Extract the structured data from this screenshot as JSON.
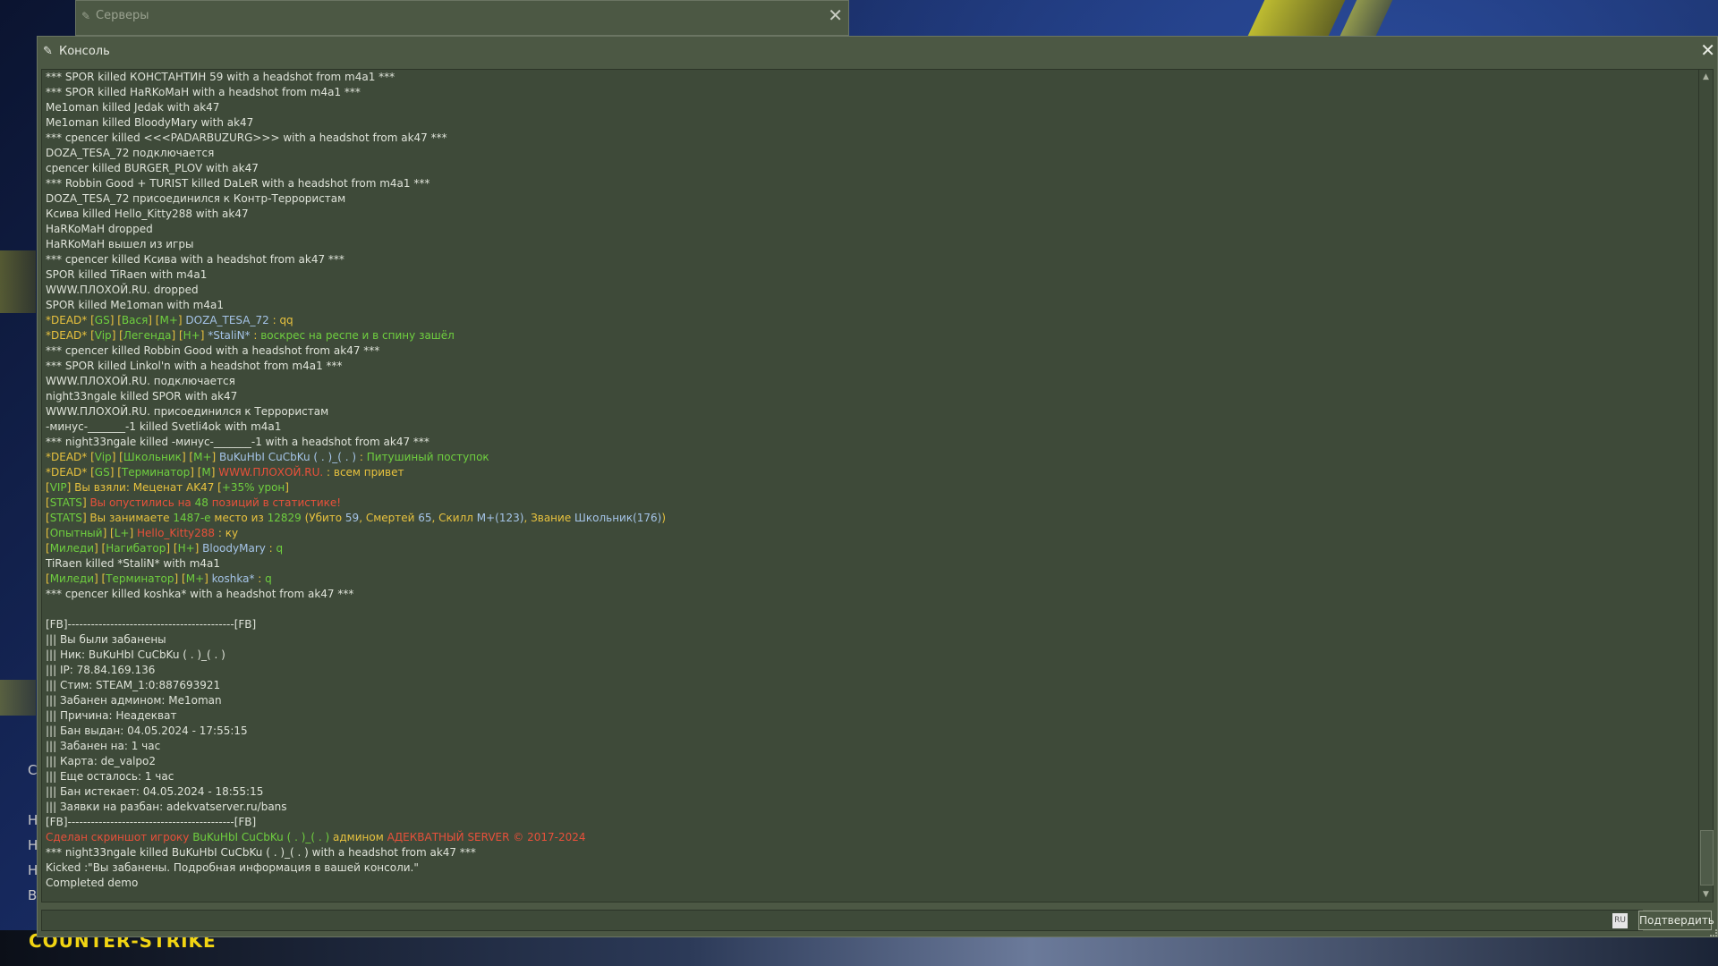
{
  "servers_window": {
    "title": "Серверы",
    "close": "✕"
  },
  "console": {
    "title": "Консоль",
    "close": "✕",
    "lang_indicator": "RU",
    "submit_label": "Подтвердить",
    "colors": {
      "default": "#dfe3d9",
      "yellow": "#e8c23e",
      "green": "#6fcf3f",
      "blue": "#a5c4e8",
      "red": "#e8503a",
      "white": "#f0f0f0"
    },
    "lines": [
      [
        {
          "t": "*** SPOR killed КОНСТАНТИН 59 with a headshot from m4a1 ***"
        }
      ],
      [
        {
          "t": "*** SPOR killed HaRKoMaH with a headshot from m4a1 ***"
        }
      ],
      [
        {
          "t": "Me1oman killed Jedak with ak47"
        }
      ],
      [
        {
          "t": "Me1oman killed BloodyMary with ak47"
        }
      ],
      [
        {
          "t": "*** cpencer killed <<<PADARBUZURG>>> with a headshot from ak47 ***"
        }
      ],
      [
        {
          "t": "DOZA_TESA_72 подключается"
        }
      ],
      [
        {
          "t": "cpencer killed BURGER_PLOV with ak47"
        }
      ],
      [
        {
          "t": "*** Robbin Good + TURIST killed DaLeR with a headshot from m4a1 ***"
        }
      ],
      [
        {
          "t": "DOZA_TESA_72 присоединился к Контр-Террористам"
        }
      ],
      [
        {
          "t": "Ксива killed Hello_Kitty288 with ak47"
        }
      ],
      [
        {
          "t": "HaRKoMaH dropped"
        }
      ],
      [
        {
          "t": "HaRKoMaH вышел из игры"
        }
      ],
      [
        {
          "t": "*** cpencer killed Ксива with a headshot from ak47 ***"
        }
      ],
      [
        {
          "t": "SPOR killed TiRaen with m4a1"
        }
      ],
      [
        {
          "t": "WWW.ПЛОХОЙ.RU. dropped"
        }
      ],
      [
        {
          "t": "SPOR killed Me1oman with m4a1"
        }
      ],
      [
        {
          "t": "*DEAD* ",
          "c": "yellow"
        },
        {
          "t": "[",
          "c": "yellow"
        },
        {
          "t": "GS",
          "c": "green"
        },
        {
          "t": "] [",
          "c": "yellow"
        },
        {
          "t": "Вася",
          "c": "green"
        },
        {
          "t": "] [",
          "c": "yellow"
        },
        {
          "t": "M+",
          "c": "green"
        },
        {
          "t": "] ",
          "c": "yellow"
        },
        {
          "t": "DOZA_TESA_72",
          "c": "blue"
        },
        {
          "t": " : qq",
          "c": "yellow"
        }
      ],
      [
        {
          "t": "*DEAD* ",
          "c": "yellow"
        },
        {
          "t": "[",
          "c": "yellow"
        },
        {
          "t": "Vip",
          "c": "green"
        },
        {
          "t": "] [",
          "c": "yellow"
        },
        {
          "t": "Легенда",
          "c": "green"
        },
        {
          "t": "] [",
          "c": "yellow"
        },
        {
          "t": "H+",
          "c": "green"
        },
        {
          "t": "] ",
          "c": "yellow"
        },
        {
          "t": "*StaliN*",
          "c": "blue"
        },
        {
          "t": " : ",
          "c": "yellow"
        },
        {
          "t": "воскрес на респе и в спину зашёл",
          "c": "green"
        }
      ],
      [
        {
          "t": "*** cpencer killed Robbin Good with a headshot from ak47 ***"
        }
      ],
      [
        {
          "t": "*** SPOR killed Linkol'n with a headshot from m4a1 ***"
        }
      ],
      [
        {
          "t": "WWW.ПЛОХОЙ.RU. подключается"
        }
      ],
      [
        {
          "t": "night33ngale killed SPOR with ak47"
        }
      ],
      [
        {
          "t": "WWW.ПЛОХОЙ.RU. присоединился к Террористам"
        }
      ],
      [
        {
          "t": "-минус-_______-1 killed Svetli4ok with m4a1"
        }
      ],
      [
        {
          "t": "*** night33ngale killed -минус-_______-1 with a headshot from ak47 ***"
        }
      ],
      [
        {
          "t": "*DEAD* ",
          "c": "yellow"
        },
        {
          "t": "[",
          "c": "yellow"
        },
        {
          "t": "Vip",
          "c": "green"
        },
        {
          "t": "] [",
          "c": "yellow"
        },
        {
          "t": "Школьник",
          "c": "green"
        },
        {
          "t": "] [",
          "c": "yellow"
        },
        {
          "t": "M+",
          "c": "green"
        },
        {
          "t": "] ",
          "c": "yellow"
        },
        {
          "t": "BuKuHbI CuCbKu ( . )_( . )",
          "c": "blue"
        },
        {
          "t": " : ",
          "c": "yellow"
        },
        {
          "t": "Питушиный поступок",
          "c": "green"
        }
      ],
      [
        {
          "t": "*DEAD* ",
          "c": "yellow"
        },
        {
          "t": "[",
          "c": "yellow"
        },
        {
          "t": "GS",
          "c": "green"
        },
        {
          "t": "] [",
          "c": "yellow"
        },
        {
          "t": "Терминатор",
          "c": "green"
        },
        {
          "t": "] [",
          "c": "yellow"
        },
        {
          "t": "M",
          "c": "green"
        },
        {
          "t": "] ",
          "c": "yellow"
        },
        {
          "t": "WWW.ПЛОХОЙ.RU.",
          "c": "red"
        },
        {
          "t": " : всем привет",
          "c": "yellow"
        }
      ],
      [
        {
          "t": "[",
          "c": "yellow"
        },
        {
          "t": "VIP",
          "c": "green"
        },
        {
          "t": "] Вы взяли: Меценат AK47 [",
          "c": "yellow"
        },
        {
          "t": "+35% урон",
          "c": "green"
        },
        {
          "t": "]",
          "c": "yellow"
        }
      ],
      [
        {
          "t": "[",
          "c": "yellow"
        },
        {
          "t": "STATS",
          "c": "green"
        },
        {
          "t": "] ",
          "c": "yellow"
        },
        {
          "t": "Вы опустились на ",
          "c": "red"
        },
        {
          "t": "48",
          "c": "green"
        },
        {
          "t": " позиций в статистике!",
          "c": "red"
        }
      ],
      [
        {
          "t": "[",
          "c": "yellow"
        },
        {
          "t": "STATS",
          "c": "green"
        },
        {
          "t": "] Вы занимаете ",
          "c": "yellow"
        },
        {
          "t": "1487-е",
          "c": "green"
        },
        {
          "t": " место из ",
          "c": "yellow"
        },
        {
          "t": "12829",
          "c": "green"
        },
        {
          "t": " (Убито ",
          "c": "yellow"
        },
        {
          "t": "59",
          "c": "blue"
        },
        {
          "t": ", Смертей ",
          "c": "yellow"
        },
        {
          "t": "65",
          "c": "blue"
        },
        {
          "t": ", Скилл ",
          "c": "yellow"
        },
        {
          "t": "M+(123)",
          "c": "blue"
        },
        {
          "t": ", Звание ",
          "c": "yellow"
        },
        {
          "t": "Школьник(176)",
          "c": "blue"
        },
        {
          "t": ")",
          "c": "yellow"
        }
      ],
      [
        {
          "t": "[",
          "c": "yellow"
        },
        {
          "t": "Опытный",
          "c": "green"
        },
        {
          "t": "] [",
          "c": "yellow"
        },
        {
          "t": "L+",
          "c": "green"
        },
        {
          "t": "] ",
          "c": "yellow"
        },
        {
          "t": "Hello_Kitty288",
          "c": "red"
        },
        {
          "t": " : ку",
          "c": "yellow"
        }
      ],
      [
        {
          "t": "[",
          "c": "yellow"
        },
        {
          "t": "Миледи",
          "c": "green"
        },
        {
          "t": "] [",
          "c": "yellow"
        },
        {
          "t": "Нагибатор",
          "c": "green"
        },
        {
          "t": "] [",
          "c": "yellow"
        },
        {
          "t": "H+",
          "c": "green"
        },
        {
          "t": "] ",
          "c": "yellow"
        },
        {
          "t": "BloodyMary",
          "c": "blue"
        },
        {
          "t": " : ",
          "c": "yellow"
        },
        {
          "t": "q",
          "c": "green"
        }
      ],
      [
        {
          "t": "TiRaen killed *StaliN* with m4a1"
        }
      ],
      [
        {
          "t": "[",
          "c": "yellow"
        },
        {
          "t": "Миледи",
          "c": "green"
        },
        {
          "t": "] [",
          "c": "yellow"
        },
        {
          "t": "Терминатор",
          "c": "green"
        },
        {
          "t": "] [",
          "c": "yellow"
        },
        {
          "t": "M+",
          "c": "green"
        },
        {
          "t": "] ",
          "c": "yellow"
        },
        {
          "t": "koshka*",
          "c": "blue"
        },
        {
          "t": " : ",
          "c": "yellow"
        },
        {
          "t": "q",
          "c": "green"
        }
      ],
      [
        {
          "t": "*** cpencer killed koshka* with a headshot from ak47 ***"
        }
      ],
      [
        {
          "t": " "
        }
      ],
      [
        {
          "t": "[FB]-------------------------------------------[FB]"
        }
      ],
      [
        {
          "t": "||| Вы были забанены"
        }
      ],
      [
        {
          "t": "||| Ник: BuKuHbI CuCbKu ( . )_( . )"
        }
      ],
      [
        {
          "t": "||| IP: 78.84.169.136"
        }
      ],
      [
        {
          "t": "||| Стим: STEAM_1:0:887693921"
        }
      ],
      [
        {
          "t": "||| Забанен админом: Me1oman"
        }
      ],
      [
        {
          "t": "||| Причина: Неадекват"
        }
      ],
      [
        {
          "t": "||| Бан выдан: 04.05.2024 - 17:55:15"
        }
      ],
      [
        {
          "t": "||| Забанен на: 1 час"
        }
      ],
      [
        {
          "t": "||| Карта: de_valpo2"
        }
      ],
      [
        {
          "t": "||| Еще осталось: 1 час"
        }
      ],
      [
        {
          "t": "||| Бан истекает: 04.05.2024 - 18:55:15"
        }
      ],
      [
        {
          "t": "||| Заявки на разбан: adekvatserver.ru/bans"
        }
      ],
      [
        {
          "t": "[FB]-------------------------------------------[FB]"
        }
      ],
      [
        {
          "t": "Сделан скриншот игроку ",
          "c": "red"
        },
        {
          "t": "BuKuHbI CuCbKu ( . )_( . )",
          "c": "green"
        },
        {
          "t": " админом ",
          "c": "yellow"
        },
        {
          "t": "АДЕКВАТНЫЙ SERVER © 2017-2024",
          "c": "red"
        }
      ],
      [
        {
          "t": "*** night33ngale killed BuKuHbI CuCbKu ( . )_( . ) with a headshot from ak47 ***"
        }
      ],
      [
        {
          "t": "Kicked :\"Вы забанены. Подробная информация в вашей консоли.\""
        }
      ],
      [
        {
          "t": "Completed demo"
        }
      ]
    ]
  },
  "background": {
    "side_letters": [
      "C",
      "Н",
      "Н",
      "Н",
      "В"
    ],
    "logo_text": "COUNTER-STRIKE"
  }
}
